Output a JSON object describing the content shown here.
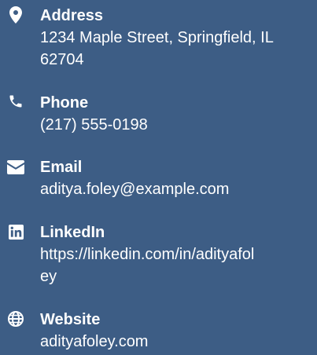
{
  "contacts": [
    {
      "label": "Address",
      "value_lines": [
        "1234 Maple Street, Springfield, IL",
        "62704"
      ],
      "icon": "map-pin-icon"
    },
    {
      "label": "Phone",
      "value_lines": [
        "(217) 555-0198"
      ],
      "icon": "phone-icon"
    },
    {
      "label": "Email",
      "value_lines": [
        "aditya.foley@example.com"
      ],
      "icon": "envelope-icon"
    },
    {
      "label": "LinkedIn",
      "value_lines": [
        "https://linkedin.com/in/adityafol",
        "ey"
      ],
      "icon": "linkedin-icon"
    },
    {
      "label": "Website",
      "value_lines": [
        "adityafoley.com"
      ],
      "icon": "globe-icon"
    }
  ],
  "colors": {
    "background": "#3d5d85",
    "text": "#ffffff"
  }
}
